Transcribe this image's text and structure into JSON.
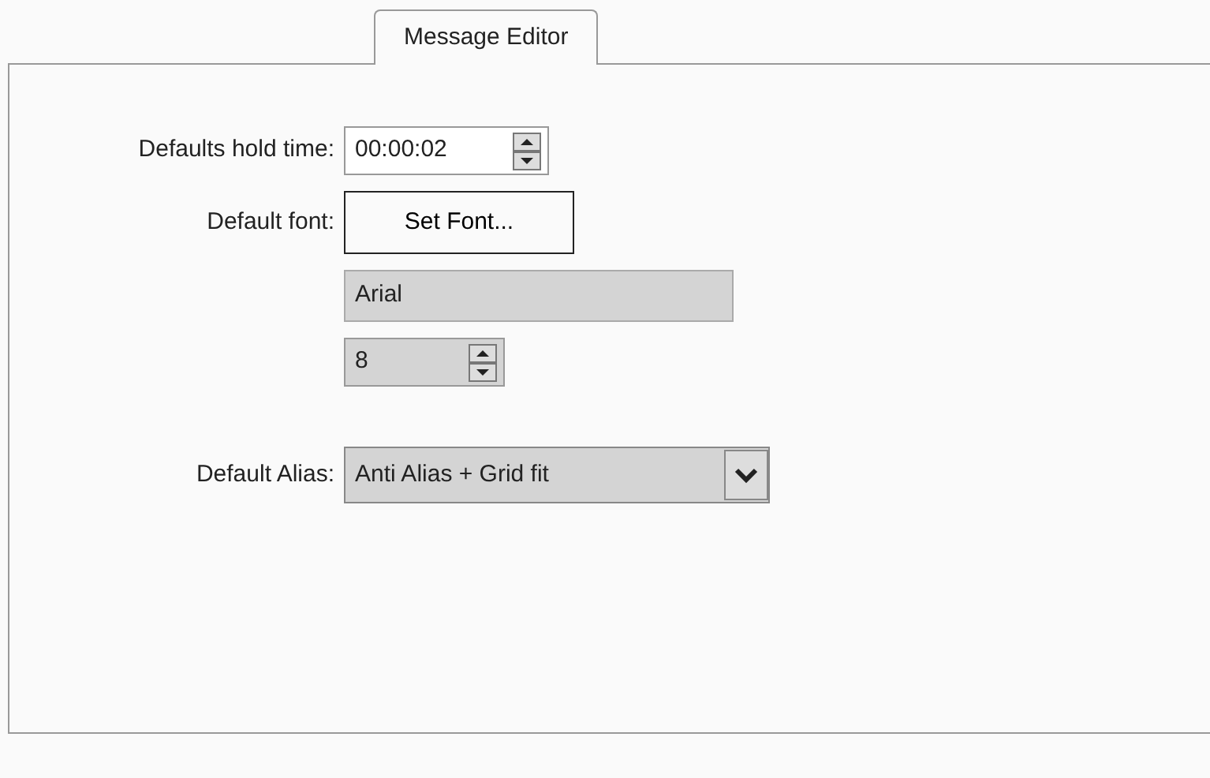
{
  "tabs": [
    {
      "label": "Message Editor",
      "selected": true
    }
  ],
  "rows": [
    {
      "label": "Defaults hold time:",
      "kind": "spinner",
      "value": "00:00:02",
      "disabled": false
    },
    {
      "label": "Default font:",
      "kind": "button",
      "value": "Set Font..."
    },
    {
      "kind": "text",
      "value": "Arial",
      "disabled": true
    },
    {
      "kind": "spinner",
      "value": "8",
      "disabled": true
    },
    {
      "label": "Default Alias:",
      "kind": "select",
      "value": "Anti Alias + Grid fit",
      "disabled": true
    }
  ]
}
